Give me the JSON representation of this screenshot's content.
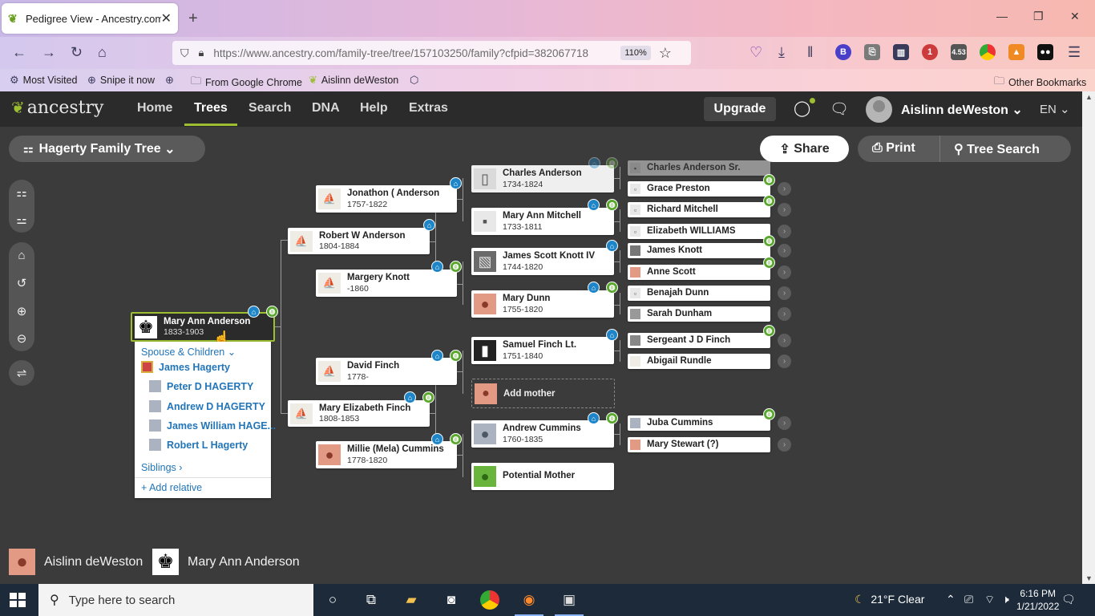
{
  "browser": {
    "tab_title": "Pedigree View - Ancestry.com",
    "url": "https://www.ancestry.com/family-tree/tree/157103250/family?cfpid=382067718",
    "zoom": "110%",
    "bookmarks": [
      "Most Visited",
      "Snipe it now",
      "From Google Chrome",
      "Aislinn deWeston"
    ],
    "other_bookmarks": "Other Bookmarks",
    "ext_badges": [
      "B",
      "1",
      "4.53"
    ]
  },
  "site": {
    "logo": "ancestry",
    "nav": [
      "Home",
      "Trees",
      "Search",
      "DNA",
      "Help",
      "Extras"
    ],
    "active_nav": "Trees",
    "upgrade": "Upgrade",
    "user": "Aislinn deWeston",
    "language": "EN"
  },
  "toolbar": {
    "tree_name": "Hagerty Family Tree",
    "share": "Share",
    "print": "Print",
    "tree_search": "Tree Search"
  },
  "focus_person": {
    "name": "Mary Ann Anderson",
    "dates": "1833-1903"
  },
  "family_panel": {
    "spouse_children": "Spouse & Children",
    "spouse": "James Hagerty",
    "children": [
      "Peter D HAGERTY",
      "Andrew D HAGERTY",
      "James William HAGE...",
      "Robert L Hagerty"
    ],
    "siblings": "Siblings",
    "add_relative": "Add relative"
  },
  "gen2": [
    {
      "name": "Robert W Anderson",
      "dates": "1804-1884"
    },
    {
      "name": "Mary Elizabeth Finch",
      "dates": "1808-1853"
    }
  ],
  "gen3": [
    {
      "name": "Jonathon ( Anderson",
      "dates": "1757-1822"
    },
    {
      "name": "Margery Knott",
      "dates": "-1860"
    },
    {
      "name": "David Finch",
      "dates": "1778-"
    },
    {
      "name": "Millie (Mela) Cummins",
      "dates": "1778-1820"
    }
  ],
  "gen4": [
    {
      "name": "Charles Anderson",
      "dates": "1734-1824"
    },
    {
      "name": "Mary Ann Mitchell",
      "dates": "1733-1811"
    },
    {
      "name": "James Scott Knott IV",
      "dates": "1744-1820"
    },
    {
      "name": "Mary Dunn",
      "dates": "1755-1820"
    },
    {
      "name": "Samuel Finch Lt.",
      "dates": "1751-1840"
    },
    {
      "name": "Add mother",
      "dates": ""
    },
    {
      "name": "Andrew Cummins",
      "dates": "1760-1835"
    },
    {
      "name": "Potential Mother",
      "dates": ""
    }
  ],
  "gen5": [
    "Charles Anderson Sr.",
    "Grace Preston",
    "Richard Mitchell",
    "Elizabeth WILLIAMS",
    "James Knott",
    "Anne Scott",
    "Benajah Dunn",
    "Sarah Dunham",
    "Sergeant J D Finch",
    "Abigail Rundle",
    "Juba Cummins",
    "Mary Stewart (?)"
  ],
  "breadcrumb": [
    "Aislinn deWeston",
    "Mary Ann Anderson"
  ],
  "taskbar": {
    "search_placeholder": "Type here to search",
    "weather": "21°F  Clear",
    "time": "6:16 PM",
    "date": "1/21/2022"
  },
  "colors": {
    "accent_green": "#9cbe30",
    "hint_blue": "#1e86c8",
    "hint_green": "#5aa72e",
    "link_blue": "#2275b8"
  }
}
